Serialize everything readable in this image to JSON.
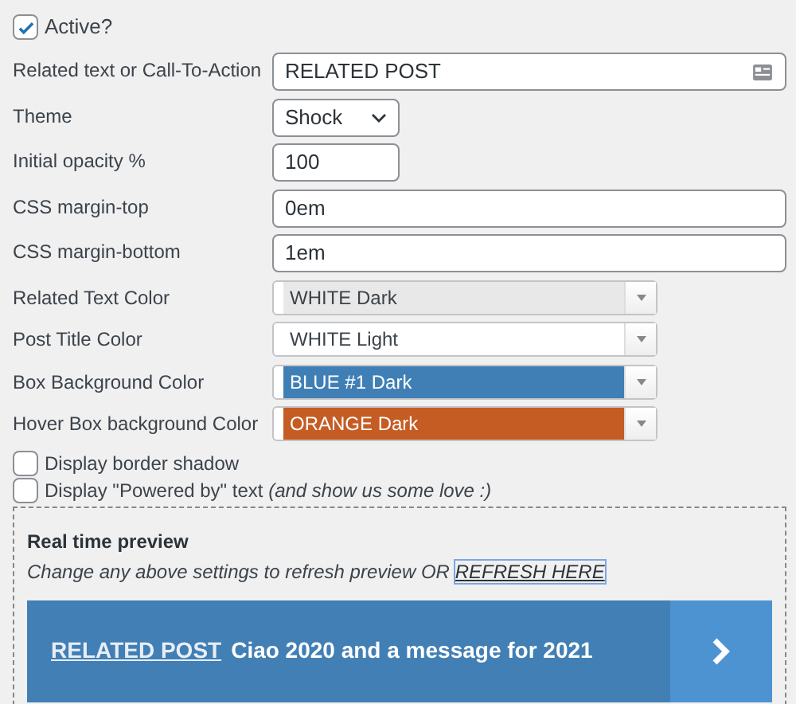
{
  "active": {
    "label": "Active?",
    "checked": true
  },
  "fields": [
    {
      "kind": "cta",
      "label": "Related text or Call-To-Action",
      "value": "RELATED POST"
    },
    {
      "kind": "select",
      "label": "Theme",
      "value": "Shock"
    },
    {
      "kind": "number",
      "label": "Initial opacity %",
      "value": "100"
    },
    {
      "kind": "text",
      "label": "CSS margin-top",
      "value": "0em"
    },
    {
      "kind": "text",
      "label": "CSS margin-bottom",
      "value": "1em"
    },
    {
      "kind": "color",
      "label": "Related Text Color",
      "value": "WHITE Dark",
      "color": "#e8e8e8"
    },
    {
      "kind": "color",
      "label": "Post Title Color",
      "value": "WHITE Light",
      "color": "#ffffff"
    },
    {
      "kind": "color",
      "label": "Box Background Color",
      "value": "BLUE #1 Dark",
      "color": "#3f7fb5"
    },
    {
      "kind": "color",
      "label": "Hover Box background Color",
      "value": "ORANGE Dark",
      "color": "#c55c24"
    }
  ],
  "options": [
    {
      "label": "Display border shadow",
      "checked": false
    },
    {
      "label": "Display \"Powered by\" text *(and show us some love :)*",
      "checked": false
    }
  ],
  "preview": {
    "title": "Real time preview",
    "hint": "Change any above settings to refresh preview OR",
    "refresh_link": "REFRESH HERE",
    "banner": {
      "tag": "RELATED POST",
      "title": "Ciao 2020 and a message for 2021"
    }
  }
}
